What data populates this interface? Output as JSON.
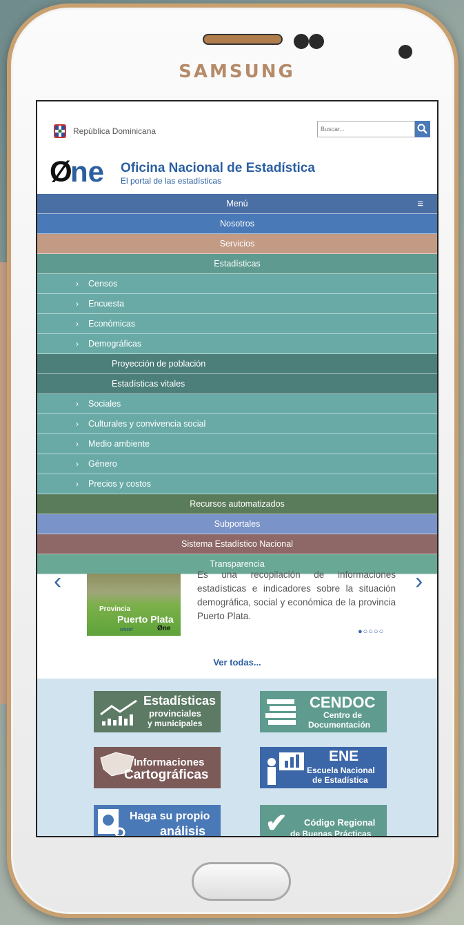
{
  "device": {
    "brand": "SAMSUNG"
  },
  "header": {
    "country": "República Dominicana",
    "search_placeholder": "Buscar...",
    "logo_text": "Øne",
    "org_title": "Oficina Nacional de Estadística",
    "org_subtitle": "El portal de las estadísticas"
  },
  "menu": {
    "title": "Menú",
    "items": [
      {
        "label": "Nosotros",
        "level": 0,
        "color": "#4a79b7"
      },
      {
        "label": "Servicios",
        "level": 0,
        "color": "#c39a84"
      },
      {
        "label": "Estadísticas",
        "level": 0,
        "color": "#5e9a90"
      },
      {
        "label": "Censos",
        "level": 1,
        "color": "#69aaa6"
      },
      {
        "label": "Encuesta",
        "level": 1,
        "color": "#69aaa6"
      },
      {
        "label": "Económicas",
        "level": 1,
        "color": "#69aaa6"
      },
      {
        "label": "Demográficas",
        "level": 1,
        "color": "#69aaa6"
      },
      {
        "label": "Proyección de población",
        "level": 2,
        "color": "#4c7e7a"
      },
      {
        "label": "Estadísticas vitales",
        "level": 2,
        "color": "#4c7e7a"
      },
      {
        "label": "Sociales",
        "level": 1,
        "color": "#69aaa6"
      },
      {
        "label": "Culturales y convivencia social",
        "level": 1,
        "color": "#69aaa6"
      },
      {
        "label": "Medio ambiente",
        "level": 1,
        "color": "#69aaa6"
      },
      {
        "label": "Género",
        "level": 1,
        "color": "#69aaa6"
      },
      {
        "label": "Precios y costos",
        "level": 1,
        "color": "#69aaa6"
      },
      {
        "label": "Recursos automatizados",
        "level": 0,
        "color": "#5b7c5a"
      },
      {
        "label": "Subportales",
        "level": 0,
        "color": "#7a93c8"
      },
      {
        "label": "Sistema Estadístico Nacional",
        "level": 0,
        "color": "#8e6866"
      },
      {
        "label": "Transparencia",
        "level": 0,
        "color": "#6aa896"
      }
    ]
  },
  "slide": {
    "book_line1": "Provincia",
    "book_line2": "Puerto Plata",
    "book_unicef": "unicef",
    "book_one": "Øne",
    "description": "Es una recopilación de informaciones estadísticas e indicadores sobre la situación demográfica, social y económica de la provincia Puerto Plata.",
    "dots": "●○○○○"
  },
  "ver_todas": "Ver todas...",
  "tiles": {
    "t1": {
      "line1": "Estadísticas",
      "line2": "provinciales",
      "line3": "y municipales"
    },
    "t2": {
      "line1": "CENDOC",
      "line2": "Centro de",
      "line3": "Documentación"
    },
    "t3": {
      "line1": "Informaciones",
      "line2": "Cartográficas"
    },
    "t4": {
      "line1": "ENE",
      "line2": "Escuela Nacional",
      "line3": "de Estadística"
    },
    "t5": {
      "line1": "Haga su propio",
      "line2": "análisis"
    },
    "t6": {
      "line1": "Código Regional",
      "line2": "de Buenas Prácticas"
    }
  }
}
